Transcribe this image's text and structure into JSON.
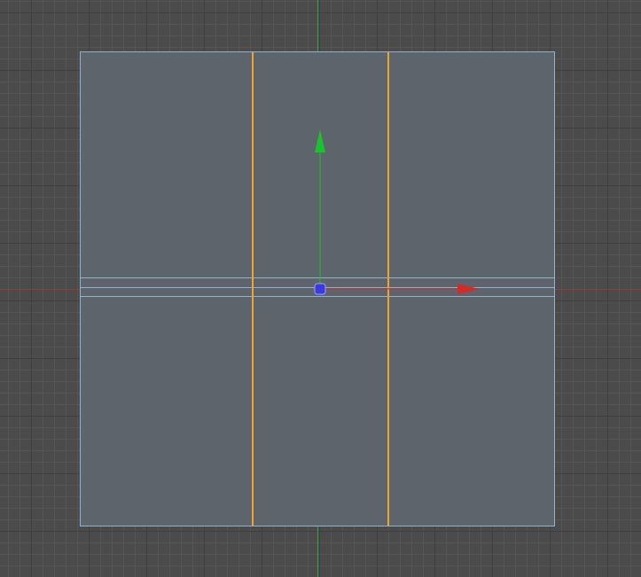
{
  "viewport": {
    "mode": "edge-selection",
    "colors": {
      "background": "#4b4b4b",
      "grid_minor": "#555555",
      "grid_major": "#3f3f3f",
      "x_axis": "#9a3636",
      "y_axis": "#2fa14a",
      "mesh_face": "#5d646b",
      "mesh_edge": "#8fb3cc",
      "selected_edge": "#f0a330",
      "gizmo_x": "#d42a2a",
      "gizmo_y": "#19c22e",
      "gizmo_center": "#3a3ae0"
    },
    "selection": {
      "selected_edges": 2
    },
    "gizmo": {
      "type": "move",
      "x_handle_icon": "arrow-right-icon",
      "y_handle_icon": "arrow-up-icon",
      "center_icon": "pivot-dot-icon"
    }
  }
}
